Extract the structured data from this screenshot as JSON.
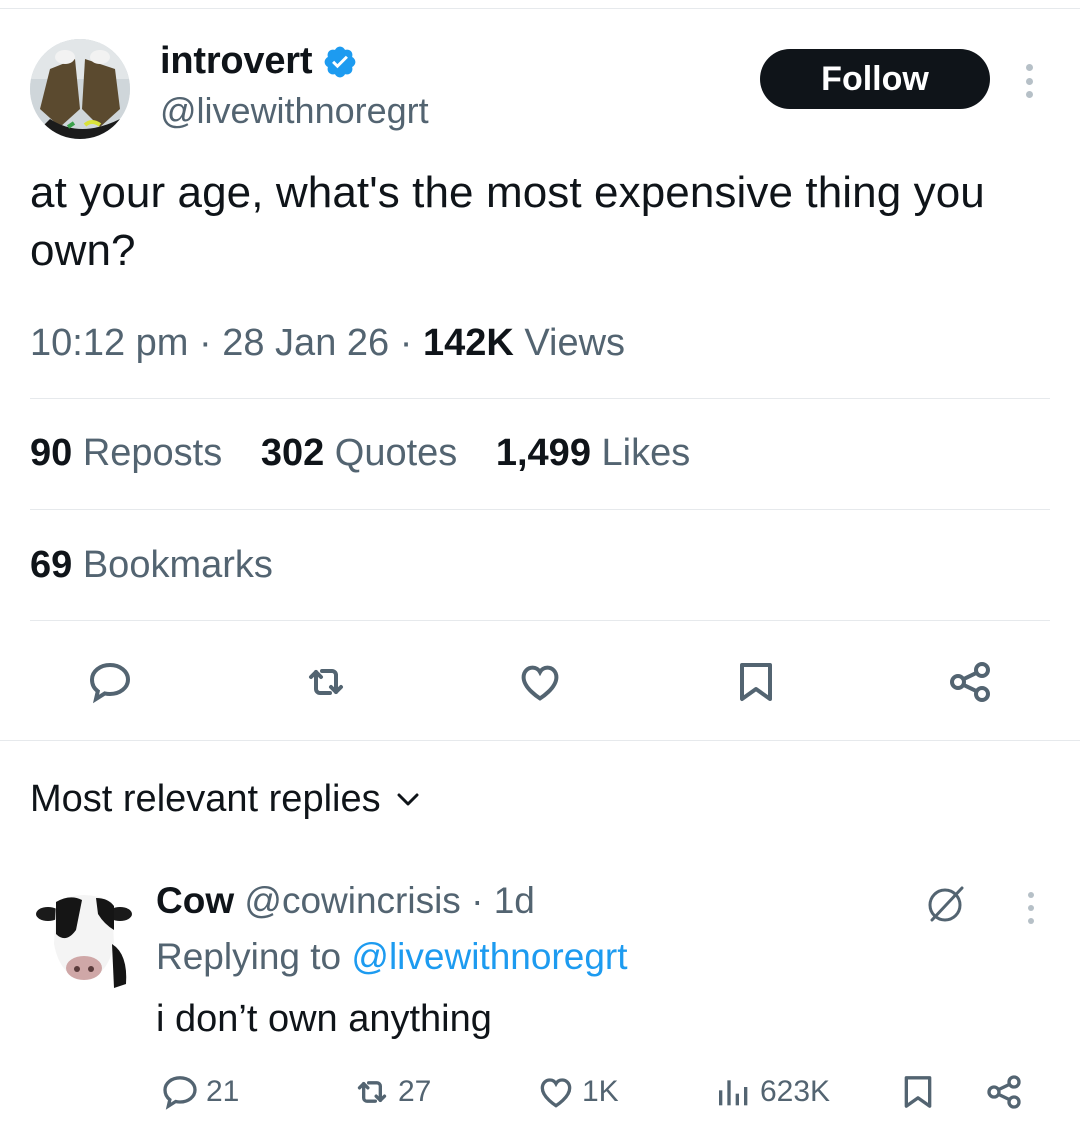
{
  "post": {
    "author_name": "introvert",
    "author_handle": "@livewithnoregrt",
    "follow_label": "Follow",
    "text": "at your age, what's the most expensive thing you own?",
    "time": "10:12 pm",
    "sep1": " · ",
    "date": "28 Jan 26",
    "sep2": " · ",
    "views_count": "142K",
    "views_label": " Views"
  },
  "stats": {
    "reposts_count": "90",
    "reposts_label": " Reposts",
    "quotes_count": "302",
    "quotes_label": " Quotes",
    "likes_count": "1,499",
    "likes_label": " Likes",
    "bookmarks_count": "69",
    "bookmarks_label": " Bookmarks"
  },
  "actions": [
    "reply-icon",
    "repost-icon",
    "like-icon",
    "bookmark-icon",
    "share-icon"
  ],
  "replies_sort_label": "Most relevant replies",
  "reply": {
    "author_name": "Cow",
    "author_handle": "@cowincrisis",
    "time_sep": " · ",
    "time": "1d",
    "replying_prefix": "Replying to ",
    "replying_handle": "@livewithnoregrt",
    "text": "i don’t own anything",
    "reply_count": "21",
    "repost_count": "27",
    "like_count": "1K",
    "views_count": "623K"
  },
  "colors": {
    "text_primary": "#0f1419",
    "text_secondary": "#536471",
    "accent": "#1d9bf0",
    "divider": "#e6e9ec"
  }
}
